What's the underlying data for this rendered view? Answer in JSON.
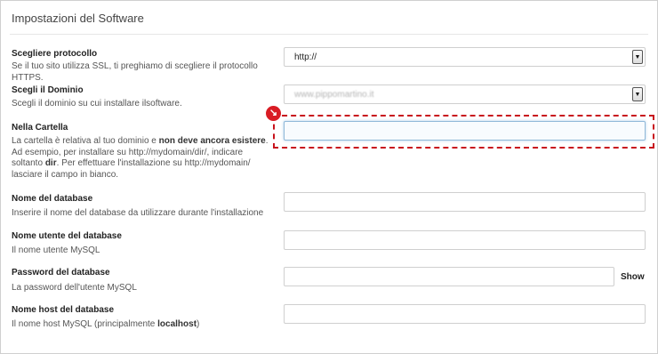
{
  "panel": {
    "title": "Impostazioni del Software"
  },
  "protocol": {
    "label": "Scegliere protocollo",
    "desc": "Se il tuo sito utilizza SSL, ti preghiamo di scegliere il protocollo HTTPS.",
    "value": "http://"
  },
  "domain": {
    "label": "Scegli il Dominio",
    "desc": "Scegli il dominio su cui installare ilsoftware.",
    "value": "www.pippomartino.it"
  },
  "folder": {
    "label": "Nella Cartella",
    "desc_1": "La cartella è relativa al tuo dominio e ",
    "desc_bold_1": "non deve ancora esistere",
    "desc_2": ". Ad esempio, per installare su http://mydomain/dir/, indicare soltanto ",
    "desc_bold_2": "dir",
    "desc_3": ". Per effettuare l'installazione su http://mydomain/ lasciare il campo in bianco.",
    "value": ""
  },
  "db_name": {
    "label": "Nome del database",
    "desc": "Inserire il nome del database da utilizzare durante l'installazione",
    "value": ""
  },
  "db_user": {
    "label": "Nome utente del database",
    "desc": "Il nome utente MySQL",
    "value": ""
  },
  "db_password": {
    "label": "Password del database",
    "desc": "La password dell'utente MySQL",
    "value": "",
    "show_label": "Show"
  },
  "db_host": {
    "label": "Nome host del database",
    "desc_1": "Il nome host MySQL (principalmente ",
    "desc_bold": "localhost",
    "desc_2": ")",
    "value": ""
  },
  "annotation": {
    "marker_icon": "arrow-down-right-icon",
    "color": "#d91c24"
  }
}
